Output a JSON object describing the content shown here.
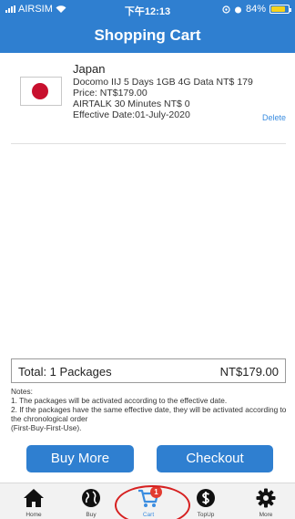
{
  "status_bar": {
    "carrier": "AIRSIM",
    "time": "下午12:13",
    "battery_label": "84%",
    "battery_level": 0.84
  },
  "header": {
    "title": "Shopping Cart"
  },
  "cart": {
    "items": [
      {
        "country": "Japan",
        "line1": "Docomo IIJ 5 Days 1GB 4G Data NT$ 179",
        "price": "Price: NT$179.00",
        "airtalk": "AIRTALK 30 Minutes NT$ 0",
        "effective_date": "Effective Date:01-July-2020",
        "delete_label": "Delete",
        "flag_icon": "japan-flag-icon"
      }
    ]
  },
  "total": {
    "label": "Total: 1 Packages",
    "amount": "NT$179.00"
  },
  "notes": {
    "heading": "Notes:",
    "line1": "1. The packages will be activated according to the effective date.",
    "line2": "2. If the packages have the same effective date, they will be activated according to the chronological order",
    "line3": "(First-Buy-First-Use)."
  },
  "buttons": {
    "buy_more": "Buy More",
    "checkout": "Checkout"
  },
  "tabs": [
    {
      "label": "Home",
      "icon": "home-icon"
    },
    {
      "label": "Buy",
      "icon": "globe-icon"
    },
    {
      "label": "Cart",
      "icon": "cart-icon",
      "badge": "1",
      "active": true
    },
    {
      "label": "TopUp",
      "icon": "dollar-icon"
    },
    {
      "label": "More",
      "icon": "gear-icon"
    }
  ],
  "colors": {
    "primary": "#2f7fd0",
    "link": "#3b8de0",
    "badge": "#e23b30",
    "highlight": "#d62020"
  }
}
